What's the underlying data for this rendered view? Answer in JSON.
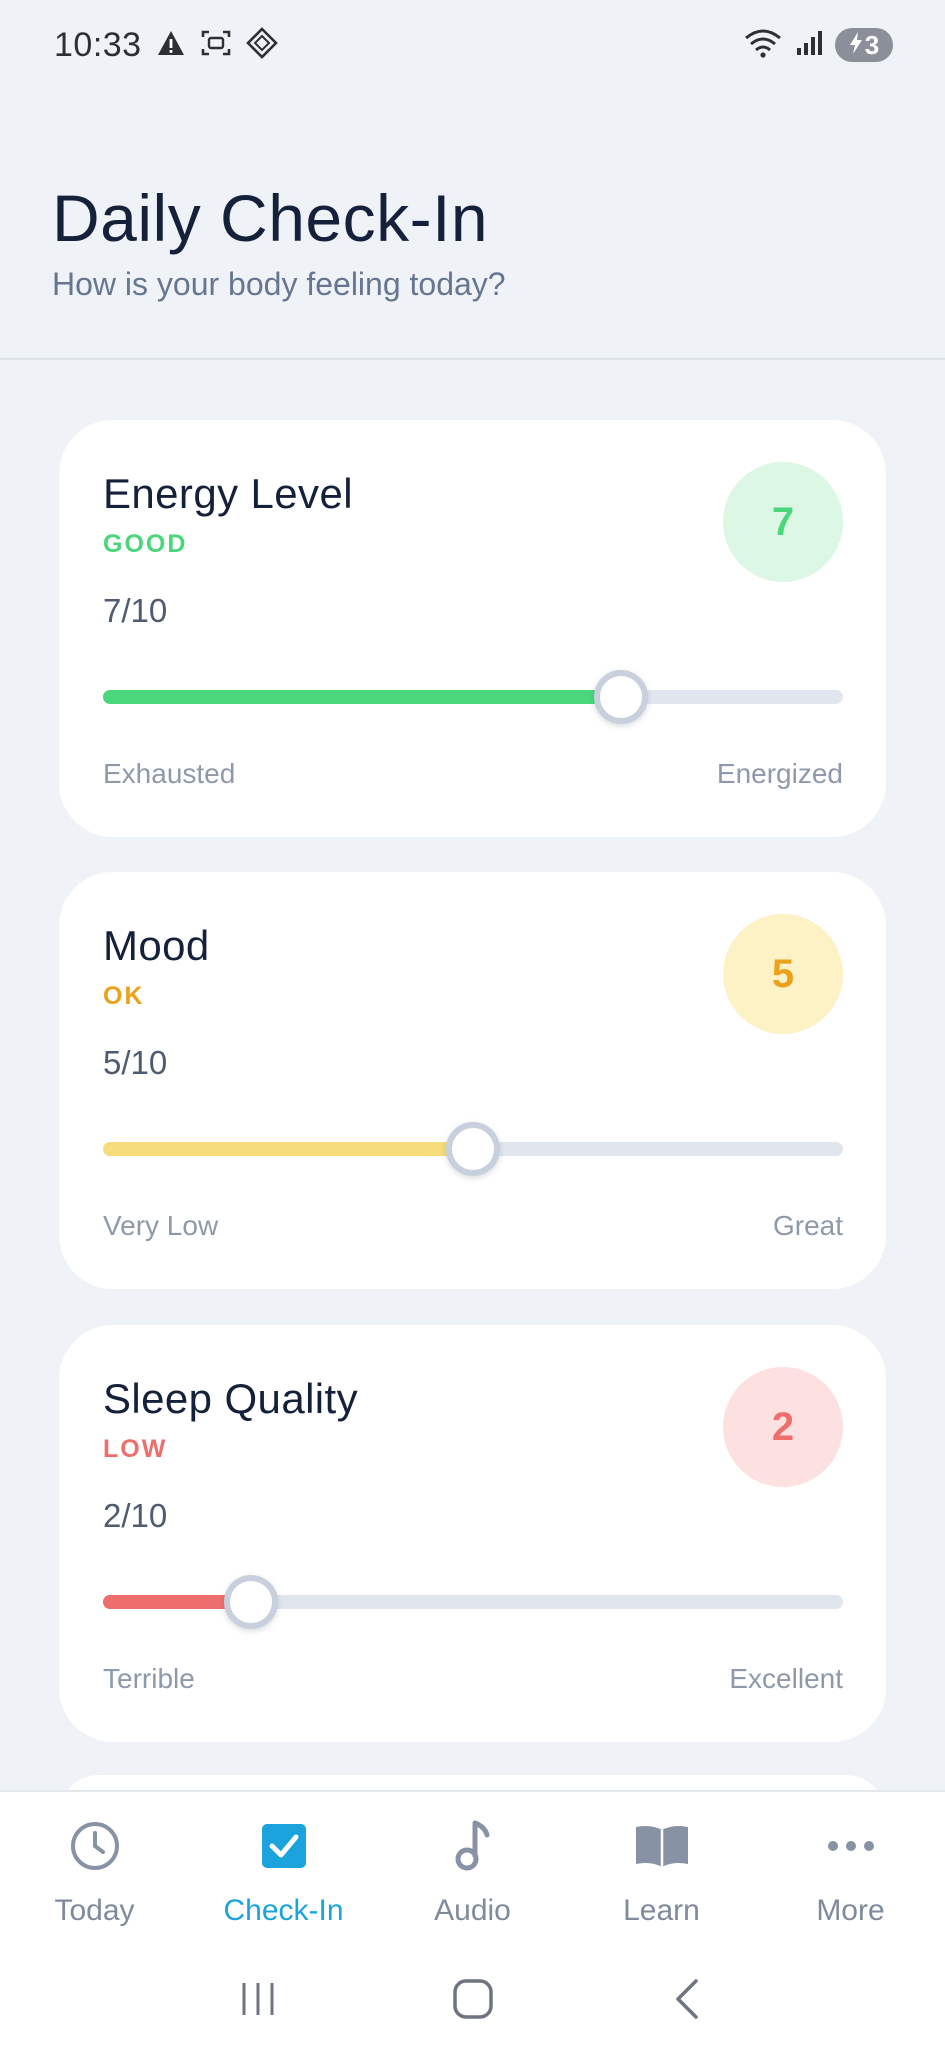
{
  "status_bar": {
    "time": "10:33",
    "battery_level": "3"
  },
  "header": {
    "title": "Daily Check-In",
    "subtitle": "How is your body feeling today?"
  },
  "cards": [
    {
      "title": "Energy Level",
      "status": "GOOD",
      "score": "7",
      "fraction": "7/10",
      "value": 7,
      "max": 10,
      "low_label": "Exhausted",
      "high_label": "Energized",
      "accent_color": "#4ad67a",
      "circle_bg": "#dcf7e4",
      "circle_text": "#4ad67a"
    },
    {
      "title": "Mood",
      "status": "OK",
      "score": "5",
      "fraction": "5/10",
      "value": 5,
      "max": 10,
      "low_label": "Very Low",
      "high_label": "Great",
      "accent_color": "#f6dc7a",
      "status_color": "#eba11a",
      "circle_bg": "#fdf2c6",
      "circle_text": "#eba11a"
    },
    {
      "title": "Sleep Quality",
      "status": "LOW",
      "score": "2",
      "fraction": "2/10",
      "value": 2,
      "max": 10,
      "low_label": "Terrible",
      "high_label": "Excellent",
      "accent_color": "#ee6e6e",
      "circle_bg": "#fde0e0",
      "circle_text": "#ee6e6e"
    }
  ],
  "bottom_nav": [
    {
      "label": "Today",
      "icon": "clock-icon",
      "active": false
    },
    {
      "label": "Check-In",
      "icon": "checkbox-icon",
      "active": true
    },
    {
      "label": "Audio",
      "icon": "music-note-icon",
      "active": false
    },
    {
      "label": "Learn",
      "icon": "book-icon",
      "active": false
    },
    {
      "label": "More",
      "icon": "more-dots-icon",
      "active": false
    }
  ],
  "colors": {
    "active_nav": "#1aa3dc",
    "inactive_nav": "#7f8a9c",
    "background": "#eff3f8"
  }
}
